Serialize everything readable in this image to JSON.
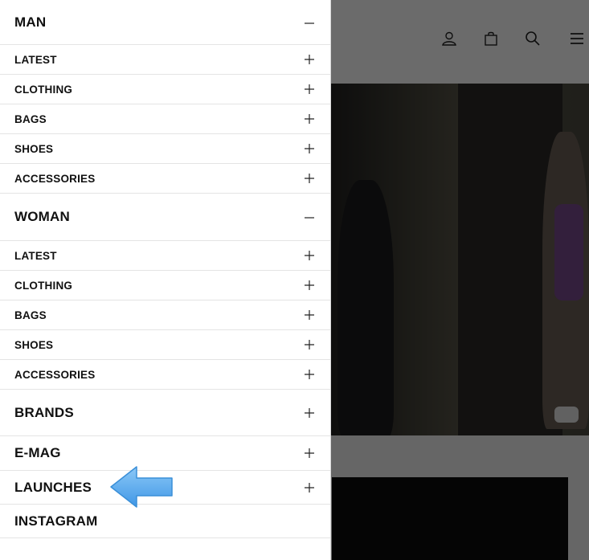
{
  "header": {
    "icons": [
      "user-icon",
      "bag-icon",
      "search-icon",
      "menu-icon"
    ]
  },
  "drawer": {
    "man": {
      "label": "MAN",
      "expanded": true,
      "items": [
        {
          "label": "LATEST"
        },
        {
          "label": "CLOTHING"
        },
        {
          "label": "BAGS"
        },
        {
          "label": "SHOES"
        },
        {
          "label": "ACCESSORIES"
        }
      ]
    },
    "woman": {
      "label": "WOMAN",
      "expanded": true,
      "items": [
        {
          "label": "LATEST"
        },
        {
          "label": "CLOTHING"
        },
        {
          "label": "BAGS"
        },
        {
          "label": "SHOES"
        },
        {
          "label": "ACCESSORIES"
        }
      ]
    },
    "brands": {
      "label": "BRANDS"
    },
    "emag": {
      "label": "E-MAG"
    },
    "launches": {
      "label": "LAUNCHES"
    },
    "instagram": {
      "label": "INSTAGRAM"
    }
  },
  "colors": {
    "arrow": "#5aaaf0",
    "text": "#111111",
    "divider": "#e4e4e4"
  }
}
